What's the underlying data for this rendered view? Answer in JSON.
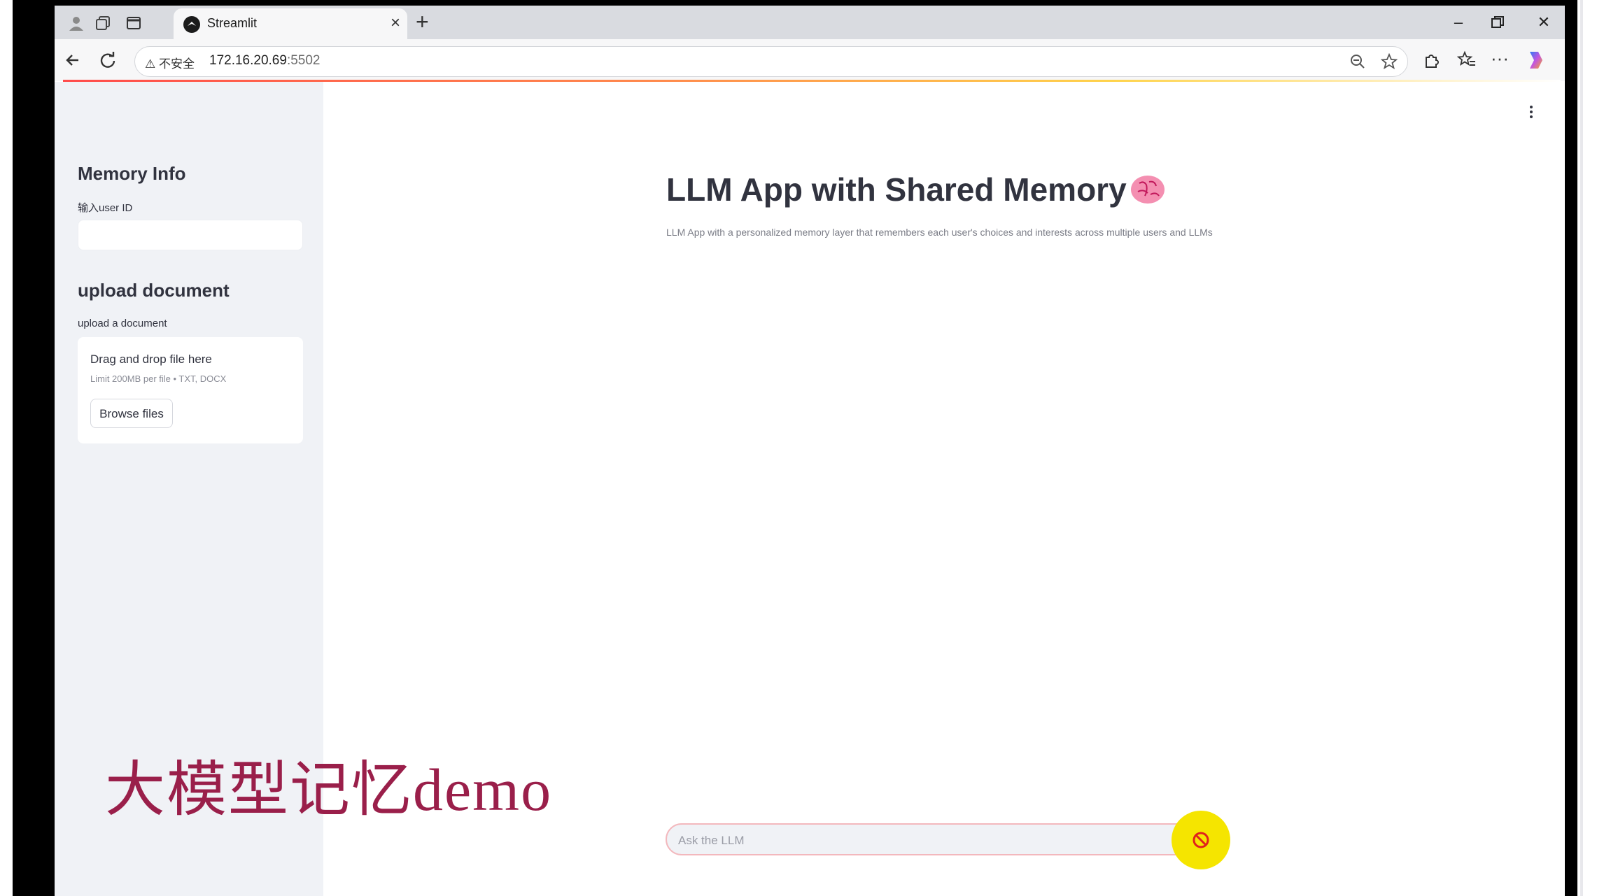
{
  "browser": {
    "tab_title": "Streamlit",
    "security_label": "不安全",
    "url_host": "172.16.20.69",
    "url_port": ":5502"
  },
  "sidebar": {
    "memory_heading": "Memory Info",
    "user_id_label": "输入user ID",
    "user_id_value": "",
    "upload_heading": "upload document",
    "upload_label": "upload a document",
    "dropzone_title": "Drag and drop file here",
    "dropzone_limit": "Limit 200MB per file • TXT, DOCX",
    "browse_button": "Browse files"
  },
  "main": {
    "title": "LLM App with Shared Memory",
    "title_emoji": "brain-icon",
    "description": "LLM App with a personalized memory layer that remembers each user's choices and interests across multiple users and LLMs"
  },
  "chat": {
    "placeholder": "Ask the LLM",
    "value": ""
  },
  "overlay": {
    "caption": "大模型记忆demo"
  },
  "colors": {
    "accent": "#ff4b4b",
    "caption": "#9a1f4a",
    "cursor_highlight": "#f5e500",
    "sidebar_bg": "#f0f2f6"
  }
}
